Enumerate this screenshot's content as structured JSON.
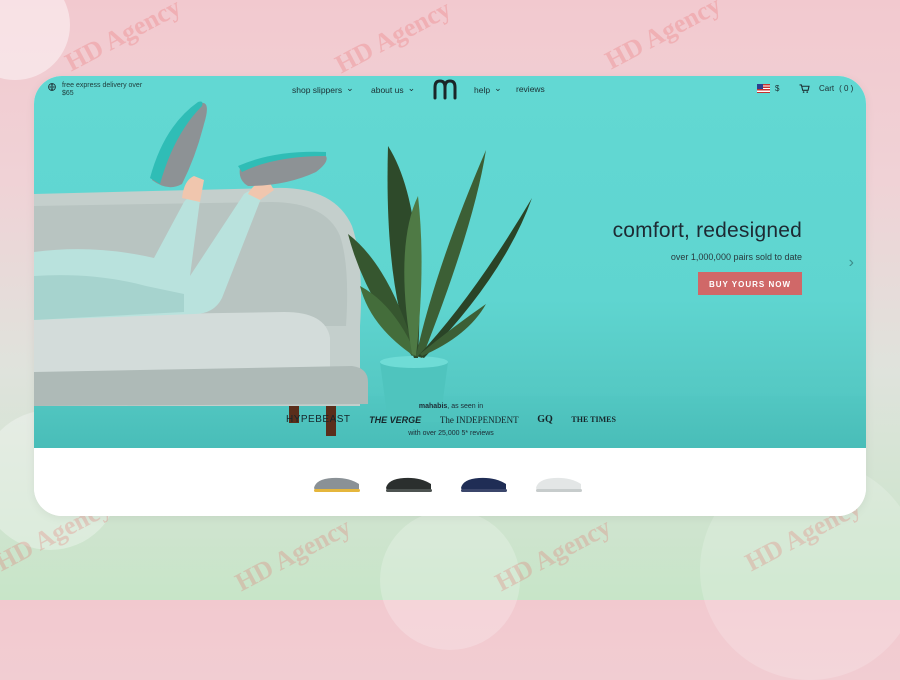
{
  "watermark": {
    "text": "HD Agency"
  },
  "topbar": {
    "delivery_text": "free express delivery over $65",
    "nav": [
      {
        "label": "shop slippers",
        "has_dropdown": true
      },
      {
        "label": "about us",
        "has_dropdown": true
      },
      {
        "label": "help",
        "has_dropdown": true
      },
      {
        "label": "reviews",
        "has_dropdown": false
      }
    ],
    "currency": "$",
    "cart": {
      "label": "Cart",
      "count": "( 0 )"
    }
  },
  "hero": {
    "headline": "comfort, redesigned",
    "subline": "over 1,000,000 pairs sold to date",
    "cta_label": "BUY YOURS NOW",
    "colors": {
      "hero_bg": "#5fd5d0",
      "cta_bg": "#d06868",
      "text_dark": "#1d2a33"
    }
  },
  "press": {
    "brand": "mahabis",
    "as_seen_in": "as seen in",
    "logos": [
      "HYPEBEAST",
      "THE VERGE",
      "The INDEPENDENT",
      "GQ",
      "THE TIMES"
    ],
    "reviews_text": "with over 25,000 5* reviews"
  },
  "products": [
    {
      "name": "grey-slipper",
      "color": "#8a9196",
      "sole": "#e5b63c"
    },
    {
      "name": "black-slipper",
      "color": "#2b2f2e",
      "sole": "#4d5351"
    },
    {
      "name": "navy-slipper",
      "color": "#1f2d55",
      "sole": "#3b466b"
    },
    {
      "name": "white-slipper",
      "color": "#e3e6e6",
      "sole": "#c7cccc"
    }
  ]
}
